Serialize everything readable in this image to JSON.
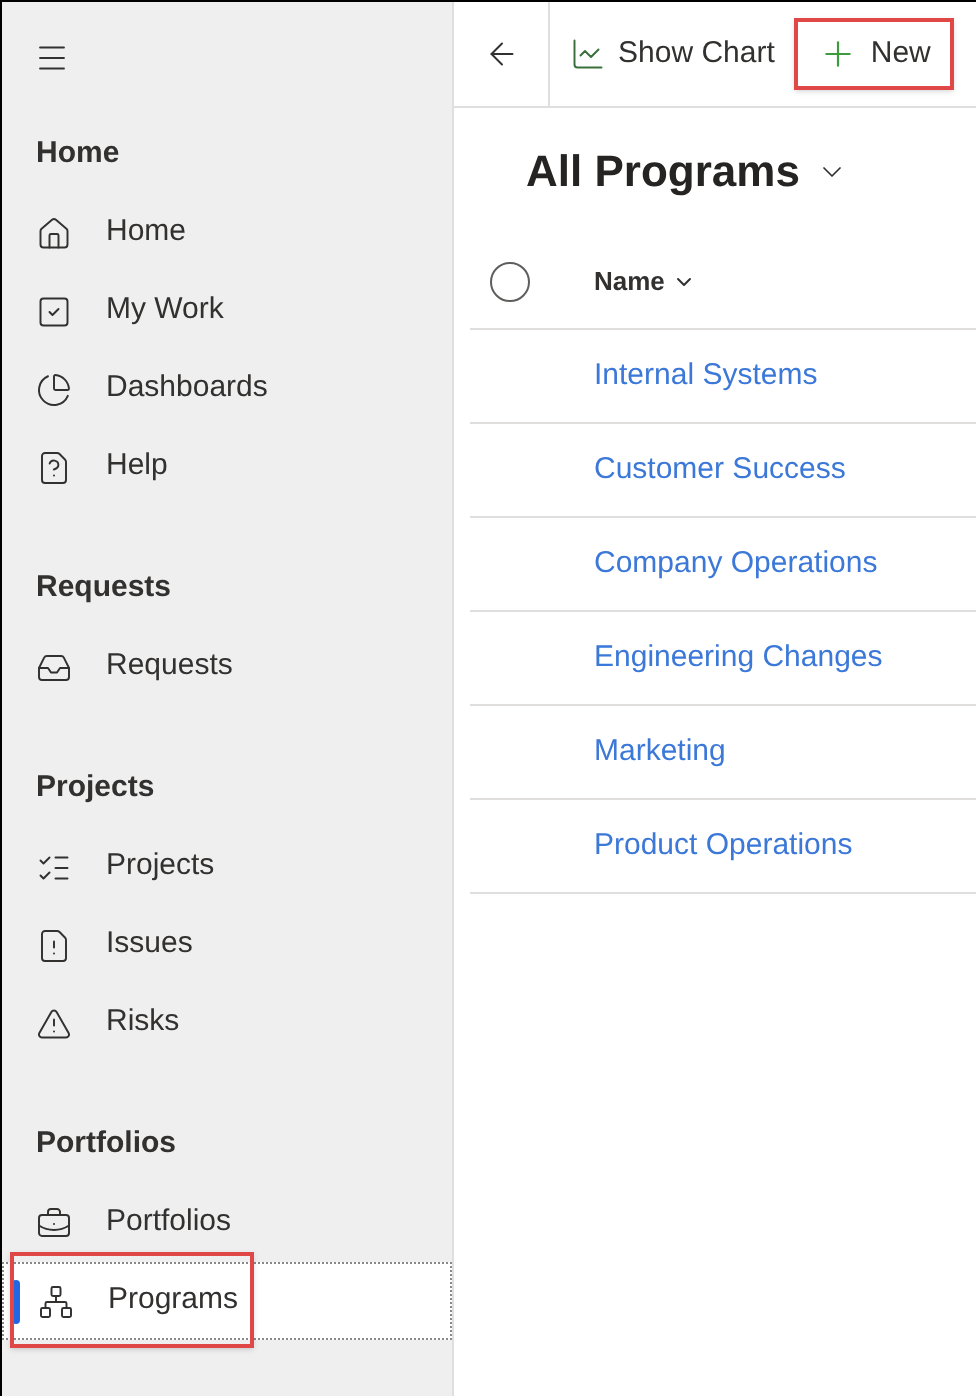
{
  "sidebar": {
    "sections": [
      {
        "title": "Home",
        "items": [
          {
            "label": "Home",
            "selected": false,
            "highlighted": false
          },
          {
            "label": "My Work",
            "selected": false,
            "highlighted": false
          },
          {
            "label": "Dashboards",
            "selected": false,
            "highlighted": false
          },
          {
            "label": "Help",
            "selected": false,
            "highlighted": false
          }
        ]
      },
      {
        "title": "Requests",
        "items": [
          {
            "label": "Requests",
            "selected": false,
            "highlighted": false
          }
        ]
      },
      {
        "title": "Projects",
        "items": [
          {
            "label": "Projects",
            "selected": false,
            "highlighted": false
          },
          {
            "label": "Issues",
            "selected": false,
            "highlighted": false
          },
          {
            "label": "Risks",
            "selected": false,
            "highlighted": false
          }
        ]
      },
      {
        "title": "Portfolios",
        "items": [
          {
            "label": "Portfolios",
            "selected": false,
            "highlighted": false
          },
          {
            "label": "Programs",
            "selected": true,
            "highlighted": true
          }
        ]
      }
    ]
  },
  "toolbar": {
    "buttons": [
      {
        "label": "Show Chart",
        "highlighted": false
      },
      {
        "label": "New",
        "highlighted": true
      }
    ]
  },
  "view": {
    "title": "All Programs"
  },
  "table": {
    "all_selected": false,
    "columns": [
      "Name"
    ],
    "rows": [
      {
        "name": "Internal Systems"
      },
      {
        "name": "Customer Success"
      },
      {
        "name": "Company Operations"
      },
      {
        "name": "Engineering Changes"
      },
      {
        "name": "Marketing"
      },
      {
        "name": "Product Operations"
      }
    ]
  }
}
